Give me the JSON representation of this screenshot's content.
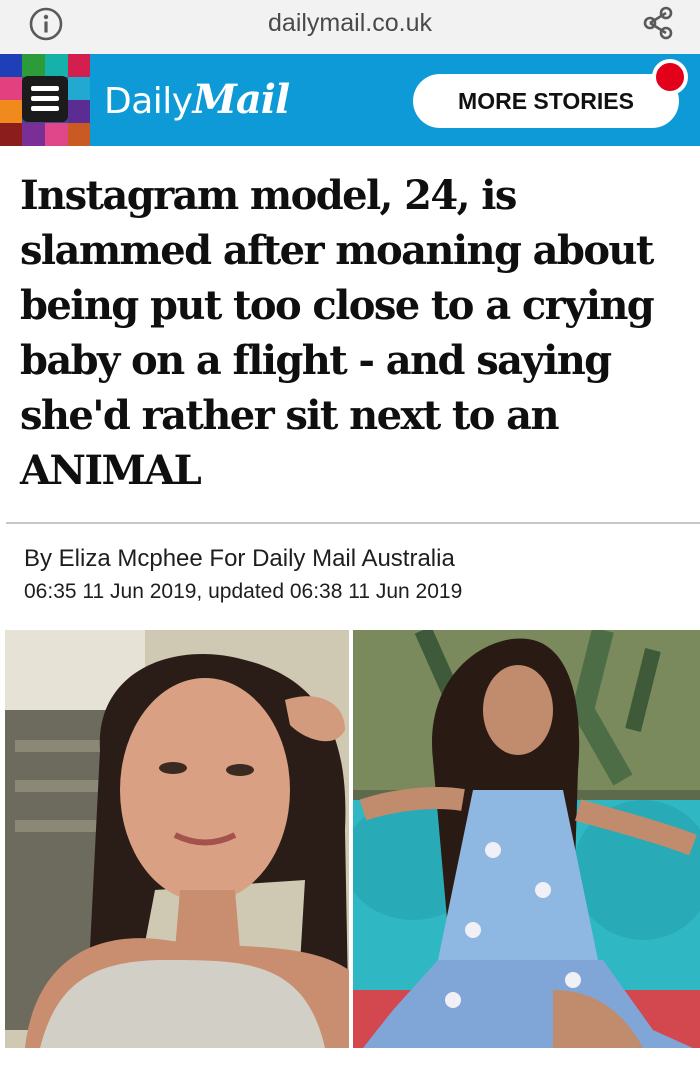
{
  "browser": {
    "url": "dailymail.co.uk"
  },
  "header": {
    "logo_daily": "Daily",
    "logo_mail": "Mail",
    "more_stories_label": "MORE STORIES",
    "accent_color": "#0d9ad6",
    "notification_color": "#e2001a"
  },
  "article": {
    "headline": "Instagram model, 24, is slammed after moaning about being put too close to a crying baby on a flight - and saying she'd rather sit next to an ANIMAL",
    "byline": "By Eliza Mcphee For Daily Mail Australia",
    "dateline": "06:35 11 Jun 2019, updated 06:38 11 Jun 2019"
  },
  "icons": {
    "info": "info-icon",
    "share": "share-icon",
    "menu": "menu-icon"
  }
}
